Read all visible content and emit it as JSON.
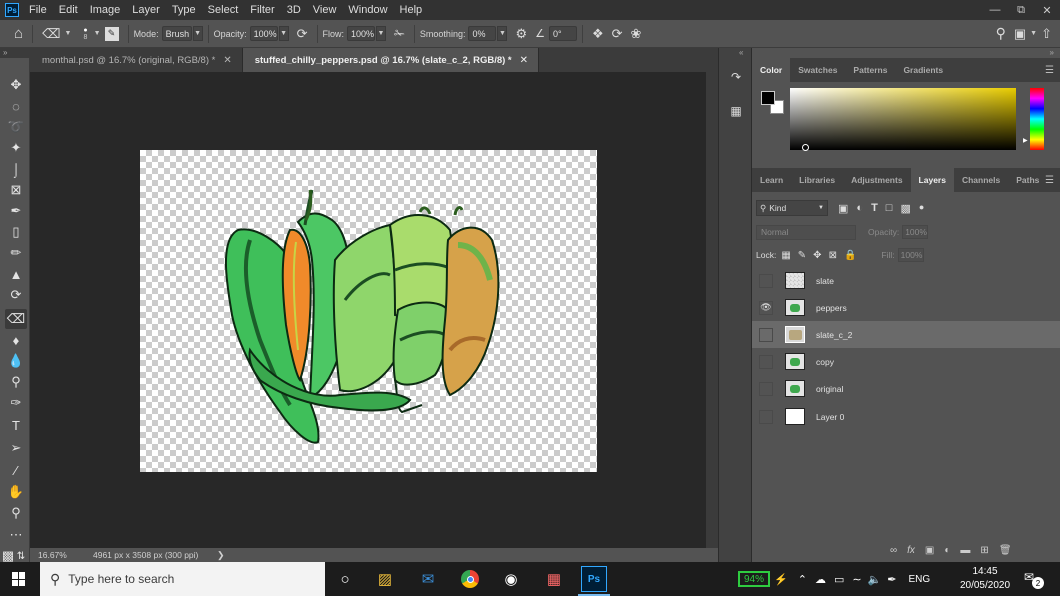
{
  "menu": {
    "app_icon": "Ps",
    "items": [
      "File",
      "Edit",
      "Image",
      "Layer",
      "Type",
      "Select",
      "Filter",
      "3D",
      "View",
      "Window",
      "Help"
    ]
  },
  "window_controls": [
    "minimize-icon",
    "restore-icon",
    "close-icon"
  ],
  "options": {
    "brush_size": "8",
    "mode_label": "Mode:",
    "mode_value": "Brush",
    "opacity_label": "Opacity:",
    "opacity_value": "100%",
    "flow_label": "Flow:",
    "flow_value": "100%",
    "smoothing_label": "Smoothing:",
    "smoothing_value": "0%",
    "angle_value": "0°"
  },
  "tabs": [
    {
      "label": "monthal.psd @ 16.7% (original, RGB/8) *",
      "active": false
    },
    {
      "label": "stuffed_chilly_peppers.psd @ 16.7% (slate_c_2, RGB/8) *",
      "active": true
    }
  ],
  "status": {
    "zoom": "16.67%",
    "doc_info": "4961 px x 3508 px (300 ppi)"
  },
  "color_panel": {
    "tabs": [
      "Color",
      "Swatches",
      "Patterns",
      "Gradients"
    ],
    "active_tab": "Color",
    "foreground": "#000000",
    "background": "#ffffff",
    "field_hue": "#e8cc00"
  },
  "layers_panel": {
    "tabs": [
      "Learn",
      "Libraries",
      "Adjustments",
      "Layers",
      "Channels",
      "Paths"
    ],
    "active_tab": "Layers",
    "filter_kind": "Kind",
    "blend_mode": "Normal",
    "opacity_label": "Opacity:",
    "opacity_value": "100%",
    "lock_label": "Lock:",
    "fill_label": "Fill:",
    "fill_value": "100%",
    "layers": [
      {
        "name": "slate",
        "visible": false,
        "selected": false
      },
      {
        "name": "peppers",
        "visible": true,
        "selected": false
      },
      {
        "name": "slate_c_2",
        "visible": false,
        "selected": true
      },
      {
        "name": "copy",
        "visible": false,
        "selected": false
      },
      {
        "name": "original",
        "visible": false,
        "selected": false
      },
      {
        "name": "Layer 0",
        "visible": false,
        "selected": false
      }
    ],
    "footer_icons": [
      "link-icon",
      "fx-icon",
      "mask-icon",
      "adjustment-icon",
      "group-folder-icon",
      "new-layer-icon",
      "trash-icon"
    ]
  },
  "taskbar": {
    "search_placeholder": "Type here to search",
    "battery": "94%",
    "language": "ENG",
    "time": "14:45",
    "date": "20/05/2020",
    "notifications": "2"
  }
}
